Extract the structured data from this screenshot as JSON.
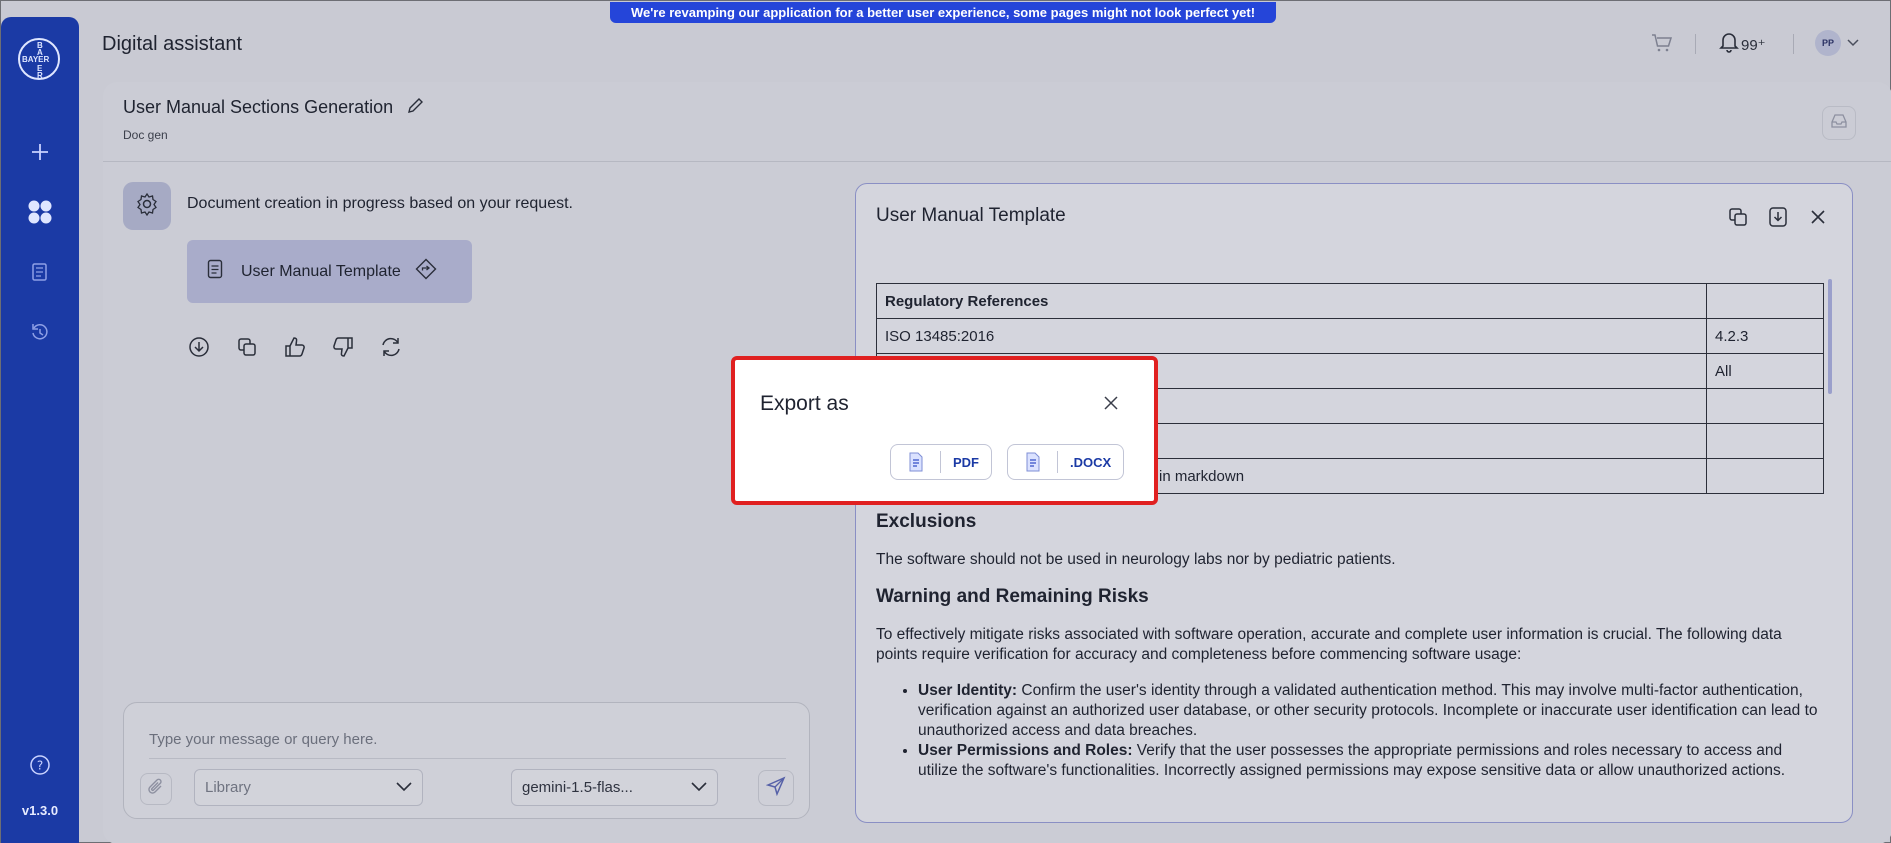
{
  "banner": {
    "text": "We're revamping our application for a better user experience, some pages might not look perfect yet!"
  },
  "app": {
    "title": "Digital assistant",
    "version": "v1.3.0"
  },
  "sidebar": {
    "logo": {
      "letters_h": "BAYER",
      "letters_v": [
        "B",
        "A",
        "Y",
        "E",
        "R"
      ]
    }
  },
  "header": {
    "notifications": "99⁺",
    "avatar_initials": "PP"
  },
  "doc": {
    "title": "User Manual Sections Generation",
    "subtitle": "Doc gen"
  },
  "chat": {
    "message": "Document creation in progress based on your request.",
    "template_chip": "User Manual Template"
  },
  "composer": {
    "placeholder": "Type your message or query here.",
    "library": "Library",
    "model": "gemini-1.5-flas..."
  },
  "panel": {
    "title": "User Manual Template",
    "table": [
      [
        "Regulatory References",
        ""
      ],
      [
        "ISO 13485:2016",
        "4.2.3"
      ],
      [
        "",
        "All"
      ],
      [
        "",
        ""
      ],
      [
        "",
        ""
      ],
      [
        "in markdown",
        ""
      ]
    ],
    "exclusions_heading": "Exclusions",
    "exclusions_text": "The software should not be used in neurology labs nor by pediatric patients.",
    "warnings_heading": "Warning and Remaining Risks",
    "warnings_text": "To effectively mitigate risks associated with software operation, accurate and complete user information is crucial. The following data points require verification for accuracy and completeness before commencing software usage:",
    "bullets": [
      {
        "title": "User Identity:",
        "text": " Confirm the user's identity through a validated authentication method. This may involve multi-factor authentication, verification against an authorized user database, or other security protocols. Incomplete or inaccurate user identification can lead to unauthorized access and data breaches."
      },
      {
        "title": "User Permissions and Roles:",
        "text": " Verify that the user possesses the appropriate permissions and roles necessary to access and utilize the software's functionalities. Incorrectly assigned permissions may expose sensitive data or allow unauthorized actions."
      }
    ]
  },
  "modal": {
    "title": "Export as",
    "pdf_label": "PDF",
    "docx_label": ".DOCX"
  },
  "colors": {
    "sidebar": "#1b3aa5",
    "accent": "#2545d9",
    "highlight": "#e02020"
  }
}
